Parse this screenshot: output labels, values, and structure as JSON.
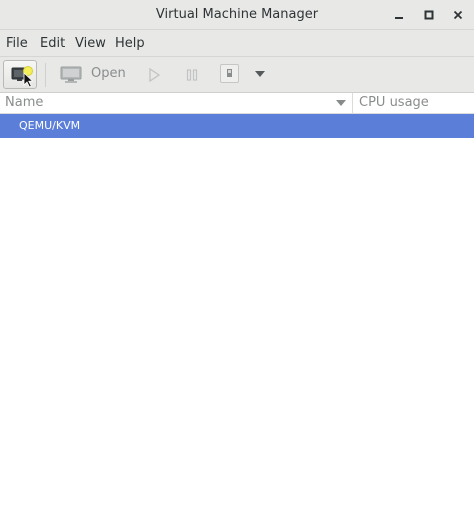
{
  "window": {
    "title": "Virtual Machine Manager"
  },
  "menubar": {
    "items": [
      "File",
      "Edit",
      "View",
      "Help"
    ]
  },
  "toolbar": {
    "new_icon": "new-vm-icon",
    "open_icon": "monitor-icon",
    "open_label": "Open",
    "run_icon": "play-icon",
    "pause_icon": "pause-icon",
    "shutdown_icon": "shutdown-icon",
    "dropdown_icon": "chevron-down-icon"
  },
  "list": {
    "columns": [
      "Name",
      "CPU usage"
    ],
    "sort_icon": "sort-descending-icon",
    "rows": [
      {
        "name": "QEMU/KVM",
        "selected": true
      }
    ]
  },
  "colors": {
    "selection": "#5b7fd8",
    "chrome": "#e8e8e7"
  }
}
